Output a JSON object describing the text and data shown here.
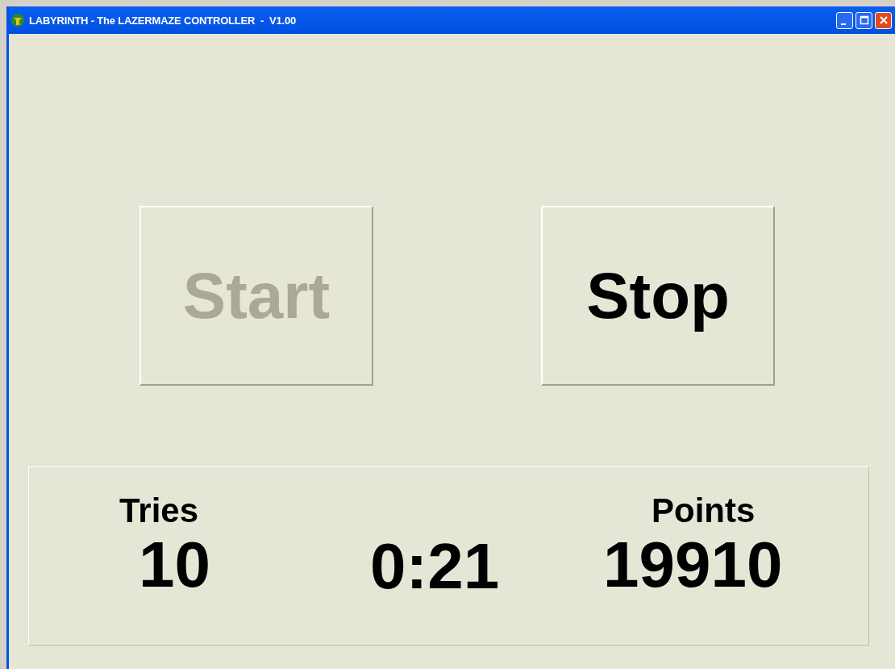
{
  "window": {
    "title": "LABYRINTH - The LAZERMAZE CONTROLLER  -  V1.00"
  },
  "buttons": [
    {
      "label": "Start",
      "disabled": true
    },
    {
      "label": "Stop",
      "disabled": false
    }
  ],
  "stats": {
    "tries_label": "Tries",
    "tries": "10",
    "time": "0:21",
    "points_label": "Points",
    "points": "19910"
  }
}
